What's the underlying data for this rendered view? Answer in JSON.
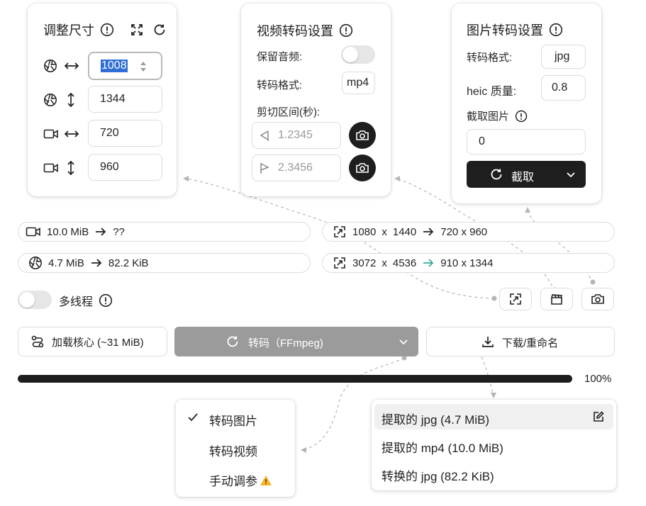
{
  "resize_panel": {
    "title": "调整尺寸",
    "image_width": "1008",
    "image_height": "1344",
    "video_width": "720",
    "video_height": "960"
  },
  "video_panel": {
    "title": "视频转码设置",
    "keep_audio_label": "保留音频:",
    "keep_audio_on": false,
    "format_label": "转码格式:",
    "format_value": "mp4",
    "clip_label": "剪切区间(秒):",
    "clip_start_placeholder": "1.2345",
    "clip_end_placeholder": "2.3456"
  },
  "image_panel": {
    "title": "图片转码设置",
    "format_label": "转码格式:",
    "format_value": "jpg",
    "heic_label": "heic 质量:",
    "heic_value": "0.8",
    "capture_label": "截取图片",
    "capture_value": "0",
    "capture_button": "截取"
  },
  "info": {
    "video_size": "10.0 MiB",
    "video_out": "??",
    "image_size": "4.7 MiB",
    "image_out": "82.2 KiB",
    "video_w": "1080",
    "video_h": "1440",
    "video_out_dim": "720 x 960",
    "image_w": "3072",
    "image_h": "4536",
    "image_out_dim": "910 x 1344",
    "times": "x",
    "accent_color": "#3aa89a"
  },
  "multithread": {
    "label": "多线程",
    "enabled": false
  },
  "actions": {
    "load_core": "加载核心 (~31 MiB)",
    "convert": "转码（FFmpeg)",
    "download": "下载/重命名"
  },
  "progress": {
    "percent": 100,
    "label": "100%"
  },
  "mode_menu": {
    "items": [
      {
        "label": "转码图片",
        "checked": true
      },
      {
        "label": "转码视频",
        "checked": false
      },
      {
        "label": "手动调参",
        "checked": false,
        "warning": true
      }
    ]
  },
  "download_menu": {
    "items": [
      {
        "label": "提取的 jpg (4.7 MiB)",
        "editable": true
      },
      {
        "label": "提取的 mp4 (10.0 MiB)"
      },
      {
        "label": "转换的 jpg (82.2 KiB)"
      }
    ]
  },
  "icons": {
    "info": "info-icon",
    "expand": "expand-icon",
    "refresh": "refresh-icon",
    "aperture": "aperture-icon",
    "video": "video-icon",
    "camera": "camera-icon",
    "clapper": "clapperboard-icon",
    "download": "download-icon",
    "edit": "edit-icon",
    "check": "check-icon",
    "warning": "warning-icon"
  }
}
